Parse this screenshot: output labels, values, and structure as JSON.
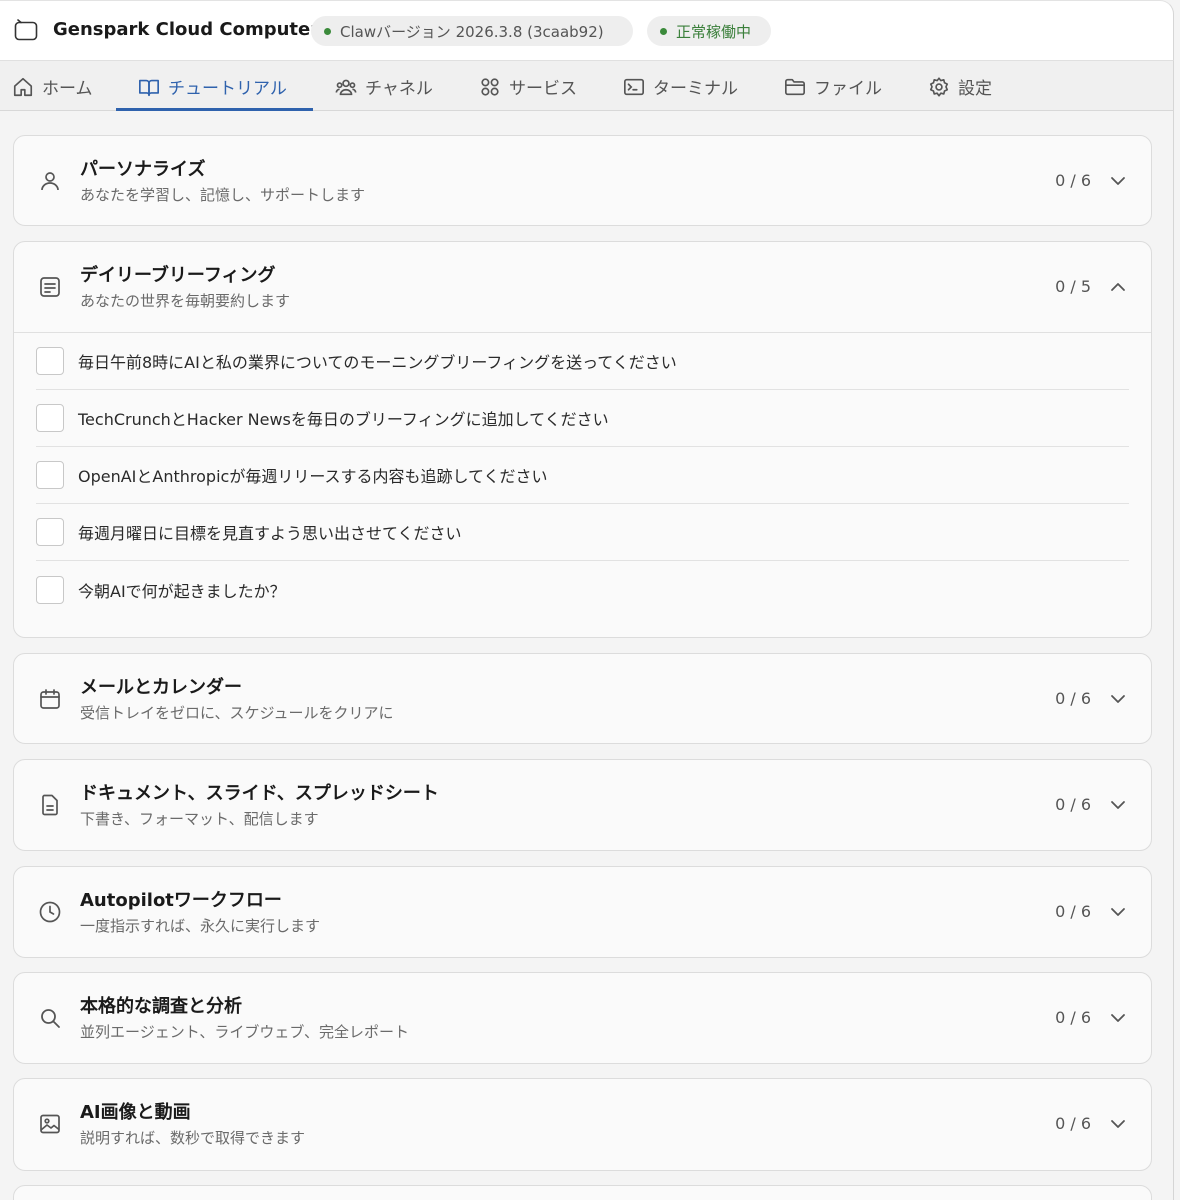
{
  "app": {
    "title": "Genspark Cloud Computer",
    "version_label": "Clawバージョン 2026.3.8 (3caab92)",
    "status_label": "正常稼働中",
    "status_color": "#3a7f3a",
    "accent_color": "#2f62ad"
  },
  "tabs": [
    {
      "label": "ホーム",
      "icon": "home-icon"
    },
    {
      "label": "チュートリアル",
      "icon": "book-icon",
      "active": true
    },
    {
      "label": "チャネル",
      "icon": "users-icon"
    },
    {
      "label": "サービス",
      "icon": "grid-icon"
    },
    {
      "label": "ターミナル",
      "icon": "terminal-icon"
    },
    {
      "label": "ファイル",
      "icon": "folder-icon"
    },
    {
      "label": "設定",
      "icon": "gear-icon"
    }
  ],
  "sections": [
    {
      "title": "パーソナライズ",
      "subtitle": "あなたを学習し、記憶し、サポートします",
      "progress": "0 / 6",
      "icon": "person-icon",
      "expanded": false
    },
    {
      "title": "デイリーブリーフィング",
      "subtitle": "あなたの世界を毎朝要約します",
      "progress": "0 / 5",
      "icon": "note-icon",
      "expanded": true,
      "tasks": [
        "毎日午前8時にAIと私の業界についてのモーニングブリーフィングを送ってください",
        "TechCrunchとHacker Newsを毎日のブリーフィングに追加してください",
        "OpenAIとAnthropicが毎週リリースする内容も追跡してください",
        "毎週月曜日に目標を見直すよう思い出させてください",
        "今朝AIで何が起きましたか？"
      ]
    },
    {
      "title": "メールとカレンダー",
      "subtitle": "受信トレイをゼロに、スケジュールをクリアに",
      "progress": "0 / 6",
      "icon": "calendar-icon",
      "expanded": false
    },
    {
      "title": "ドキュメント、スライド、スプレッドシート",
      "subtitle": "下書き、フォーマット、配信します",
      "progress": "0 / 6",
      "icon": "document-icon",
      "expanded": false
    },
    {
      "title": "Autopilotワークフロー",
      "subtitle": "一度指示すれば、永久に実行します",
      "progress": "0 / 6",
      "icon": "clock-icon",
      "expanded": false
    },
    {
      "title": "本格的な調査と分析",
      "subtitle": "並列エージェント、ライブウェブ、完全レポート",
      "progress": "0 / 6",
      "icon": "search-icon",
      "expanded": false
    },
    {
      "title": "AI画像と動画",
      "subtitle": "説明すれば、数秒で取得できます",
      "progress": "0 / 6",
      "icon": "image-icon",
      "expanded": false
    }
  ]
}
